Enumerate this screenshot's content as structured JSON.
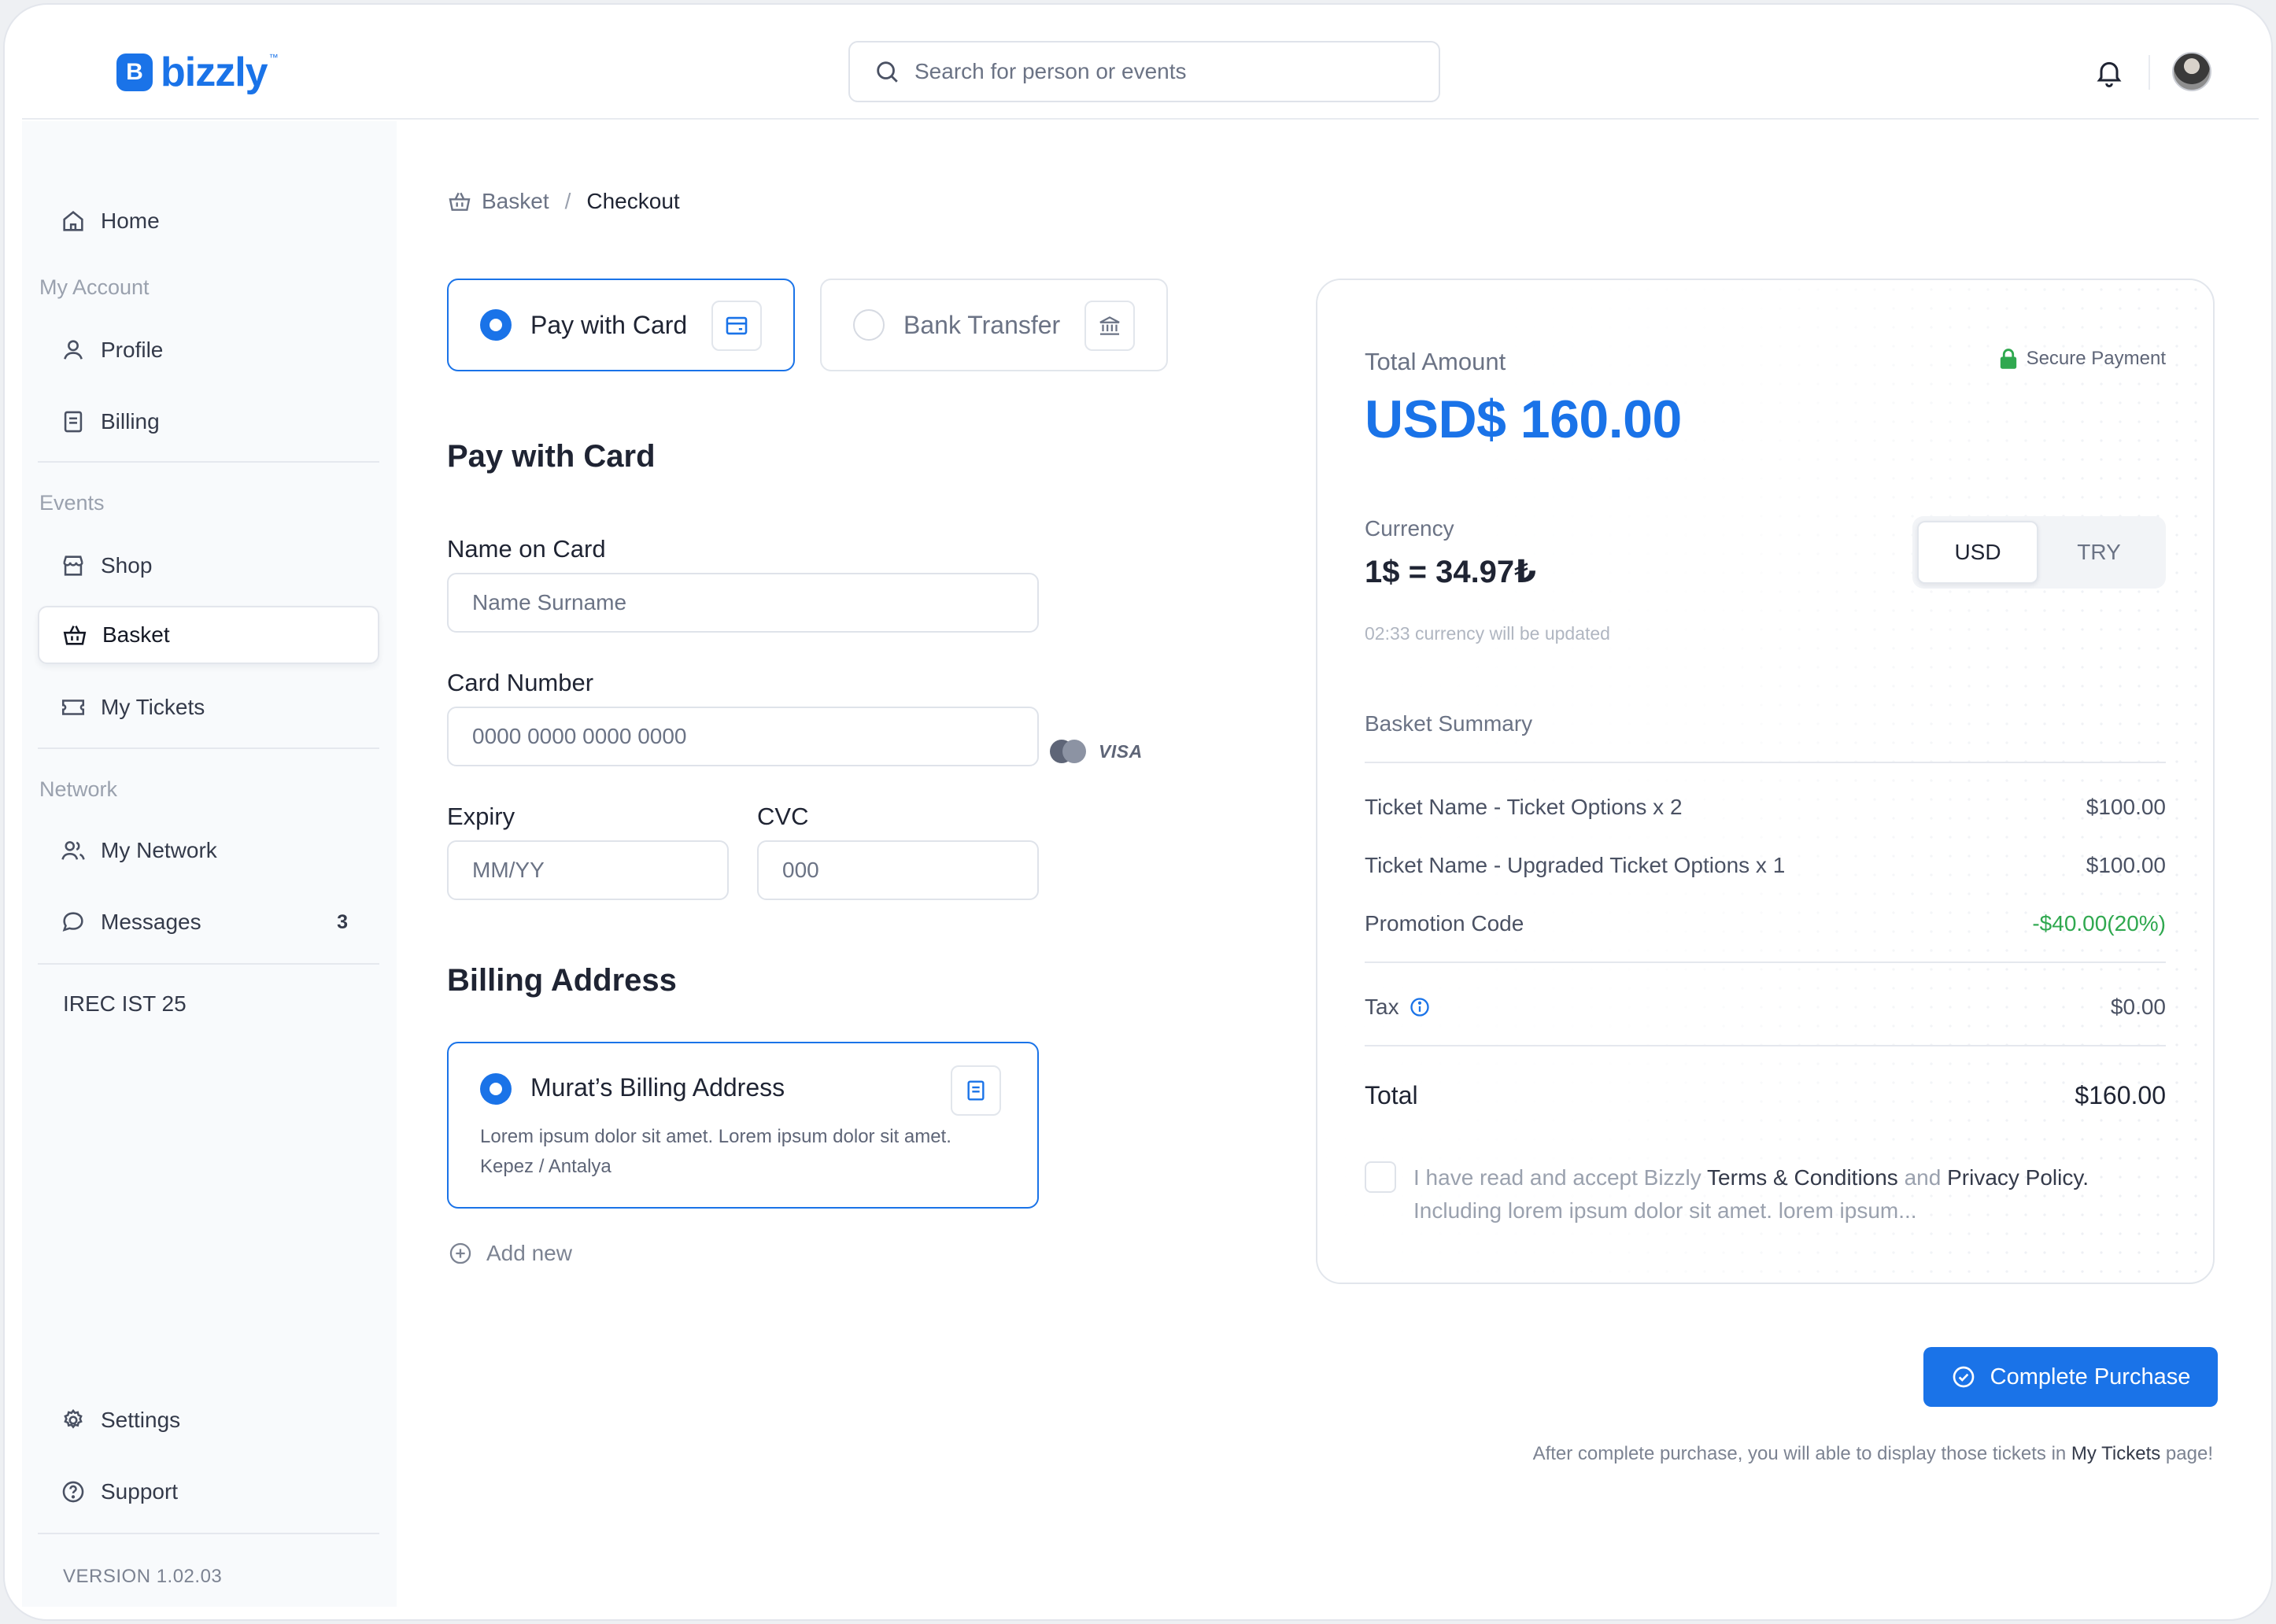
{
  "header": {
    "logo_text": "bizzly",
    "logo_mark": "B",
    "logo_tm": "™",
    "search_placeholder": "Search for person or events"
  },
  "sidebar": {
    "home": "Home",
    "section_account": "My Account",
    "profile": "Profile",
    "billing": "Billing",
    "section_events": "Events",
    "shop": "Shop",
    "basket": "Basket",
    "my_tickets": "My Tickets",
    "section_network": "Network",
    "my_network": "My Network",
    "messages": "Messages",
    "messages_count": "3",
    "event_item": "IREC IST 25",
    "settings": "Settings",
    "support": "Support",
    "version": "VERSION 1.02.03"
  },
  "breadcrumb": {
    "basket": "Basket",
    "separator": "/",
    "current": "Checkout"
  },
  "payment": {
    "option_card": "Pay with Card",
    "option_bank": "Bank Transfer",
    "selected": "card",
    "section_title": "Pay with Card",
    "name_label": "Name on Card",
    "name_placeholder": "Name Surname",
    "card_label": "Card Number",
    "card_placeholder": "0000 0000 0000 0000",
    "card_brand_visa": "VISA",
    "expiry_label": "Expiry",
    "expiry_placeholder": "MM/YY",
    "cvc_label": "CVC",
    "cvc_placeholder": "000"
  },
  "billing": {
    "section_title": "Billing Address",
    "address_title": "Murat’s Billing Address",
    "address_text": "Lorem ipsum dolor sit amet. Lorem ipsum dolor sit amet. Kepez / Antalya",
    "add_new": "Add new"
  },
  "summary": {
    "total_label": "Total Amount",
    "secure_label": "Secure Payment",
    "total_amount": "USD$ 160.00",
    "currency_label": "Currency",
    "rate": "1$ = 34.97₺",
    "currency_note": "02:33 currency will be updated",
    "currency_options": [
      "USD",
      "TRY"
    ],
    "currency_selected": "USD",
    "basket_summary_label": "Basket Summary",
    "items": [
      {
        "name": "Ticket Name - Ticket Options x 2",
        "price": "$100.00"
      },
      {
        "name": "Ticket Name - Upgraded Ticket Options x 1",
        "price": "$100.00"
      }
    ],
    "promotion_label": "Promotion Code",
    "promotion_value": "-$40.00(20%)",
    "tax_label": "Tax",
    "tax_value": "$0.00",
    "grand_total_label": "Total",
    "grand_total_value": "$160.00",
    "terms_pre": "I have read and accept Bizzly ",
    "terms_link1": "Terms & Conditions",
    "terms_mid": " and ",
    "terms_link2": "Privacy Policy.",
    "terms_line2": "Including lorem ipsum dolor sit amet. lorem ipsum..."
  },
  "actions": {
    "complete_label": "Complete Purchase",
    "after_note_pre": "After complete purchase, you will able to display those tickets in ",
    "after_note_link": "My Tickets",
    "after_note_post": " page!"
  },
  "colors": {
    "accent": "#1a73e8",
    "success": "#2fa84f",
    "border": "#e2e6ec",
    "sidebar_bg": "#f8fafc"
  },
  "icons": [
    "search-icon",
    "bell-icon",
    "home-icon",
    "user-icon",
    "document-icon",
    "store-icon",
    "basket-icon",
    "ticket-icon",
    "users-icon",
    "chat-icon",
    "gear-icon",
    "help-icon",
    "card-icon",
    "bank-icon",
    "lock-icon",
    "info-icon",
    "check-circle-icon",
    "plus-circle-icon"
  ]
}
